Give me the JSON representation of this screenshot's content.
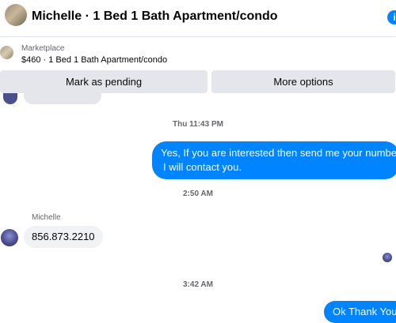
{
  "header": {
    "title": "Michelle · 1 Bed 1 Bath Apartment/condo",
    "info_icon": "i"
  },
  "marketplace": {
    "label": "Marketplace",
    "listing": "$460 · 1 Bed 1 Bath Apartment/condo"
  },
  "actions": {
    "mark_pending": "Mark as pending",
    "more_options": "More options"
  },
  "messages": {
    "timestamp_1": "Thu 11:43 PM",
    "outgoing_1_line1": "Yes, If you are interested then send me your number",
    "outgoing_1_line2": "I will contact you.",
    "timestamp_2": "2:50 AM",
    "sender_name": "Michelle",
    "incoming_1": "856.873.2210",
    "timestamp_3": "3:42 AM",
    "outgoing_2": "Ok Thank You"
  },
  "colors": {
    "accent": "#0084ff",
    "button_bg": "#e4e6eb",
    "incoming_bubble": "#f0f2f5",
    "meta_text": "#65676b"
  }
}
